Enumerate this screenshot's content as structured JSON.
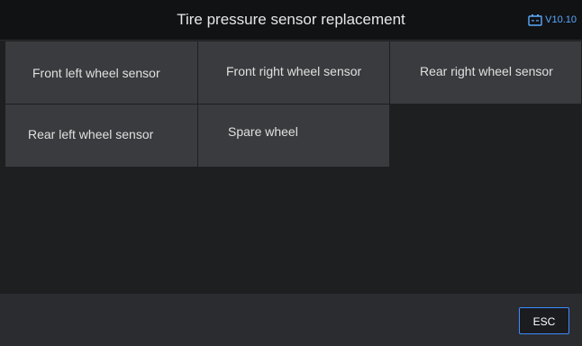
{
  "header": {
    "title": "Tire pressure sensor replacement",
    "version": "V10.10",
    "version_icon": "battery-icon"
  },
  "menu": {
    "items": [
      {
        "label": "Front left wheel sensor"
      },
      {
        "label": "Front right wheel sensor"
      },
      {
        "label": "Rear right wheel sensor"
      },
      {
        "label": "Rear left wheel sensor"
      },
      {
        "label": "Spare wheel"
      }
    ]
  },
  "footer": {
    "esc_label": "ESC"
  },
  "colors": {
    "accent": "#3d8bff",
    "header_bg": "#111214",
    "cell_bg": "#3a3b3e",
    "page_bg": "#1e1f21",
    "footer_bg": "#2b2c30"
  }
}
